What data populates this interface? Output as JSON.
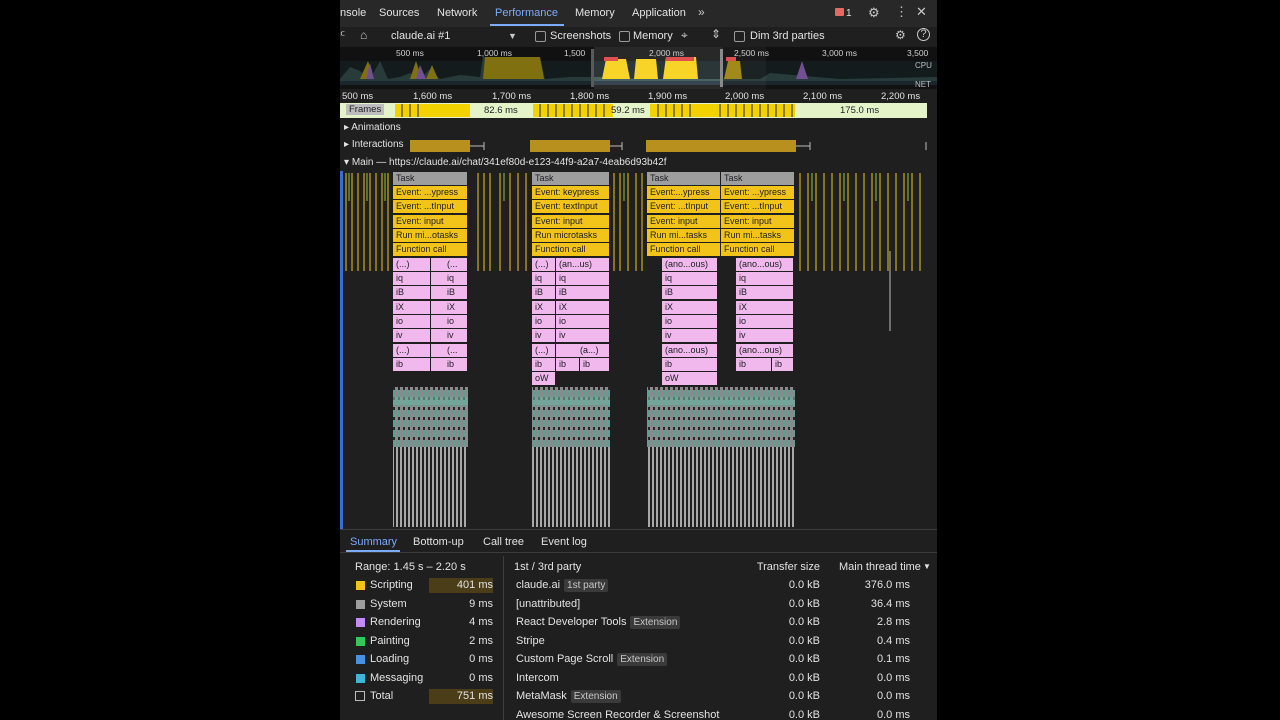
{
  "tabs": {
    "items": [
      {
        "label": "nsole"
      },
      {
        "label": "Sources"
      },
      {
        "label": "Network"
      },
      {
        "label": "Performance"
      },
      {
        "label": "Memory"
      },
      {
        "label": "Application"
      }
    ],
    "more_icon": "chevrons-right-icon",
    "issues_count": "1"
  },
  "toolbar": {
    "target": "claude.ai #1",
    "screenshots_label": "Screenshots",
    "memory_label": "Memory",
    "dim_label": "Dim 3rd parties"
  },
  "overview": {
    "ticks": [
      "500 ms",
      "1,000 ms",
      "1,500",
      "2,000 ms",
      "2,500 ms",
      "3,000 ms",
      "3,500"
    ],
    "cpu_label": "CPU",
    "net_label": "NET"
  },
  "ruler": {
    "ticks": [
      "500 ms",
      "1,600 ms",
      "1,700 ms",
      "1,800 ms",
      "1,900 ms",
      "2,000 ms",
      "2,100 ms",
      "2,200 ms"
    ]
  },
  "tracks": {
    "frames_label": "Frames",
    "frame_durations": [
      "82.6 ms",
      "59.2 ms",
      "175.0 ms"
    ],
    "animations_label": "Animations",
    "interactions_label": "Interactions",
    "main_label": "Main — https://claude.ai/chat/341ef80d-e123-44f9-a2a7-4eab6d93b42f"
  },
  "flame": {
    "g1": [
      "Task",
      "Event: ...ypress",
      "Event: ...tInput",
      "Event: input",
      "Run mi...otasks",
      "Function call"
    ],
    "g1a": [
      "(...)",
      "iq",
      "iB",
      "iX",
      "io",
      "iv",
      "(...)",
      "ib"
    ],
    "g1b": [
      "(...",
      "iq",
      "iB",
      "iX",
      "io",
      "iv",
      "(...",
      "ib"
    ],
    "g2": [
      "Task",
      "Event: keypress",
      "Event: textInput",
      "Event: input",
      "Run microtasks",
      "Function call"
    ],
    "g2a": [
      "(...)",
      "iq",
      "iB",
      "iX",
      "io",
      "iv",
      "(...)",
      "ib",
      "oW"
    ],
    "g2b": [
      "(an...us)",
      "iq",
      "iB",
      "iX",
      "io",
      "iv",
      "(a...)",
      "ib"
    ],
    "g2c": "ib",
    "g3": [
      "Task",
      "Event:...ypress",
      "Event: ...tInput",
      "Event: input",
      "Run mi...tasks",
      "Function call"
    ],
    "g3a": [
      "(ano...ous)",
      "iq",
      "iB",
      "iX",
      "io",
      "iv",
      "(ano...ous)",
      "ib",
      "oW"
    ],
    "g4": [
      "Task",
      "Event: ...ypress",
      "Event: ...tInput",
      "Event: input",
      "Run mi...tasks",
      "Function call"
    ],
    "g4a": [
      "(ano...ous)",
      "iq",
      "iB",
      "iX",
      "io",
      "iv",
      "(ano...ous)",
      "ib"
    ],
    "g4b": "ib"
  },
  "bottom": {
    "tabs": [
      "Summary",
      "Bottom-up",
      "Call tree",
      "Event log"
    ],
    "range": "Range: 1.45 s – 2.20 s",
    "categories": [
      {
        "name": "Scripting",
        "value": "401 ms",
        "color": "#f2c41a"
      },
      {
        "name": "System",
        "value": "9 ms",
        "color": "#9e9e9e"
      },
      {
        "name": "Rendering",
        "value": "4 ms",
        "color": "#c58af9"
      },
      {
        "name": "Painting",
        "value": "2 ms",
        "color": "#34c759"
      },
      {
        "name": "Loading",
        "value": "0 ms",
        "color": "#4a90e2"
      },
      {
        "name": "Messaging",
        "value": "0 ms",
        "color": "#3fb6d6"
      },
      {
        "name": "Total",
        "value": "751 ms",
        "color": ""
      }
    ],
    "table_headers": [
      "1st / 3rd party",
      "Transfer size",
      "Main thread time"
    ],
    "rows": [
      {
        "name": "claude.ai",
        "badge": "1st party",
        "size": "0.0 kB",
        "time": "376.0 ms"
      },
      {
        "name": "[unattributed]",
        "badge": "",
        "size": "0.0 kB",
        "time": "36.4 ms"
      },
      {
        "name": "React Developer Tools",
        "badge": "Extension",
        "size": "0.0 kB",
        "time": "2.8 ms"
      },
      {
        "name": "Stripe",
        "badge": "",
        "size": "0.0 kB",
        "time": "0.4 ms"
      },
      {
        "name": "Custom Page Scroll",
        "badge": "Extension",
        "size": "0.0 kB",
        "time": "0.1 ms"
      },
      {
        "name": "Intercom",
        "badge": "",
        "size": "0.0 kB",
        "time": "0.0 ms"
      },
      {
        "name": "MetaMask",
        "badge": "Extension",
        "size": "0.0 kB",
        "time": "0.0 ms"
      },
      {
        "name": "Awesome Screen Recorder & Screenshot",
        "badge": "",
        "size": "0.0 kB",
        "time": "0.0 ms"
      }
    ]
  }
}
